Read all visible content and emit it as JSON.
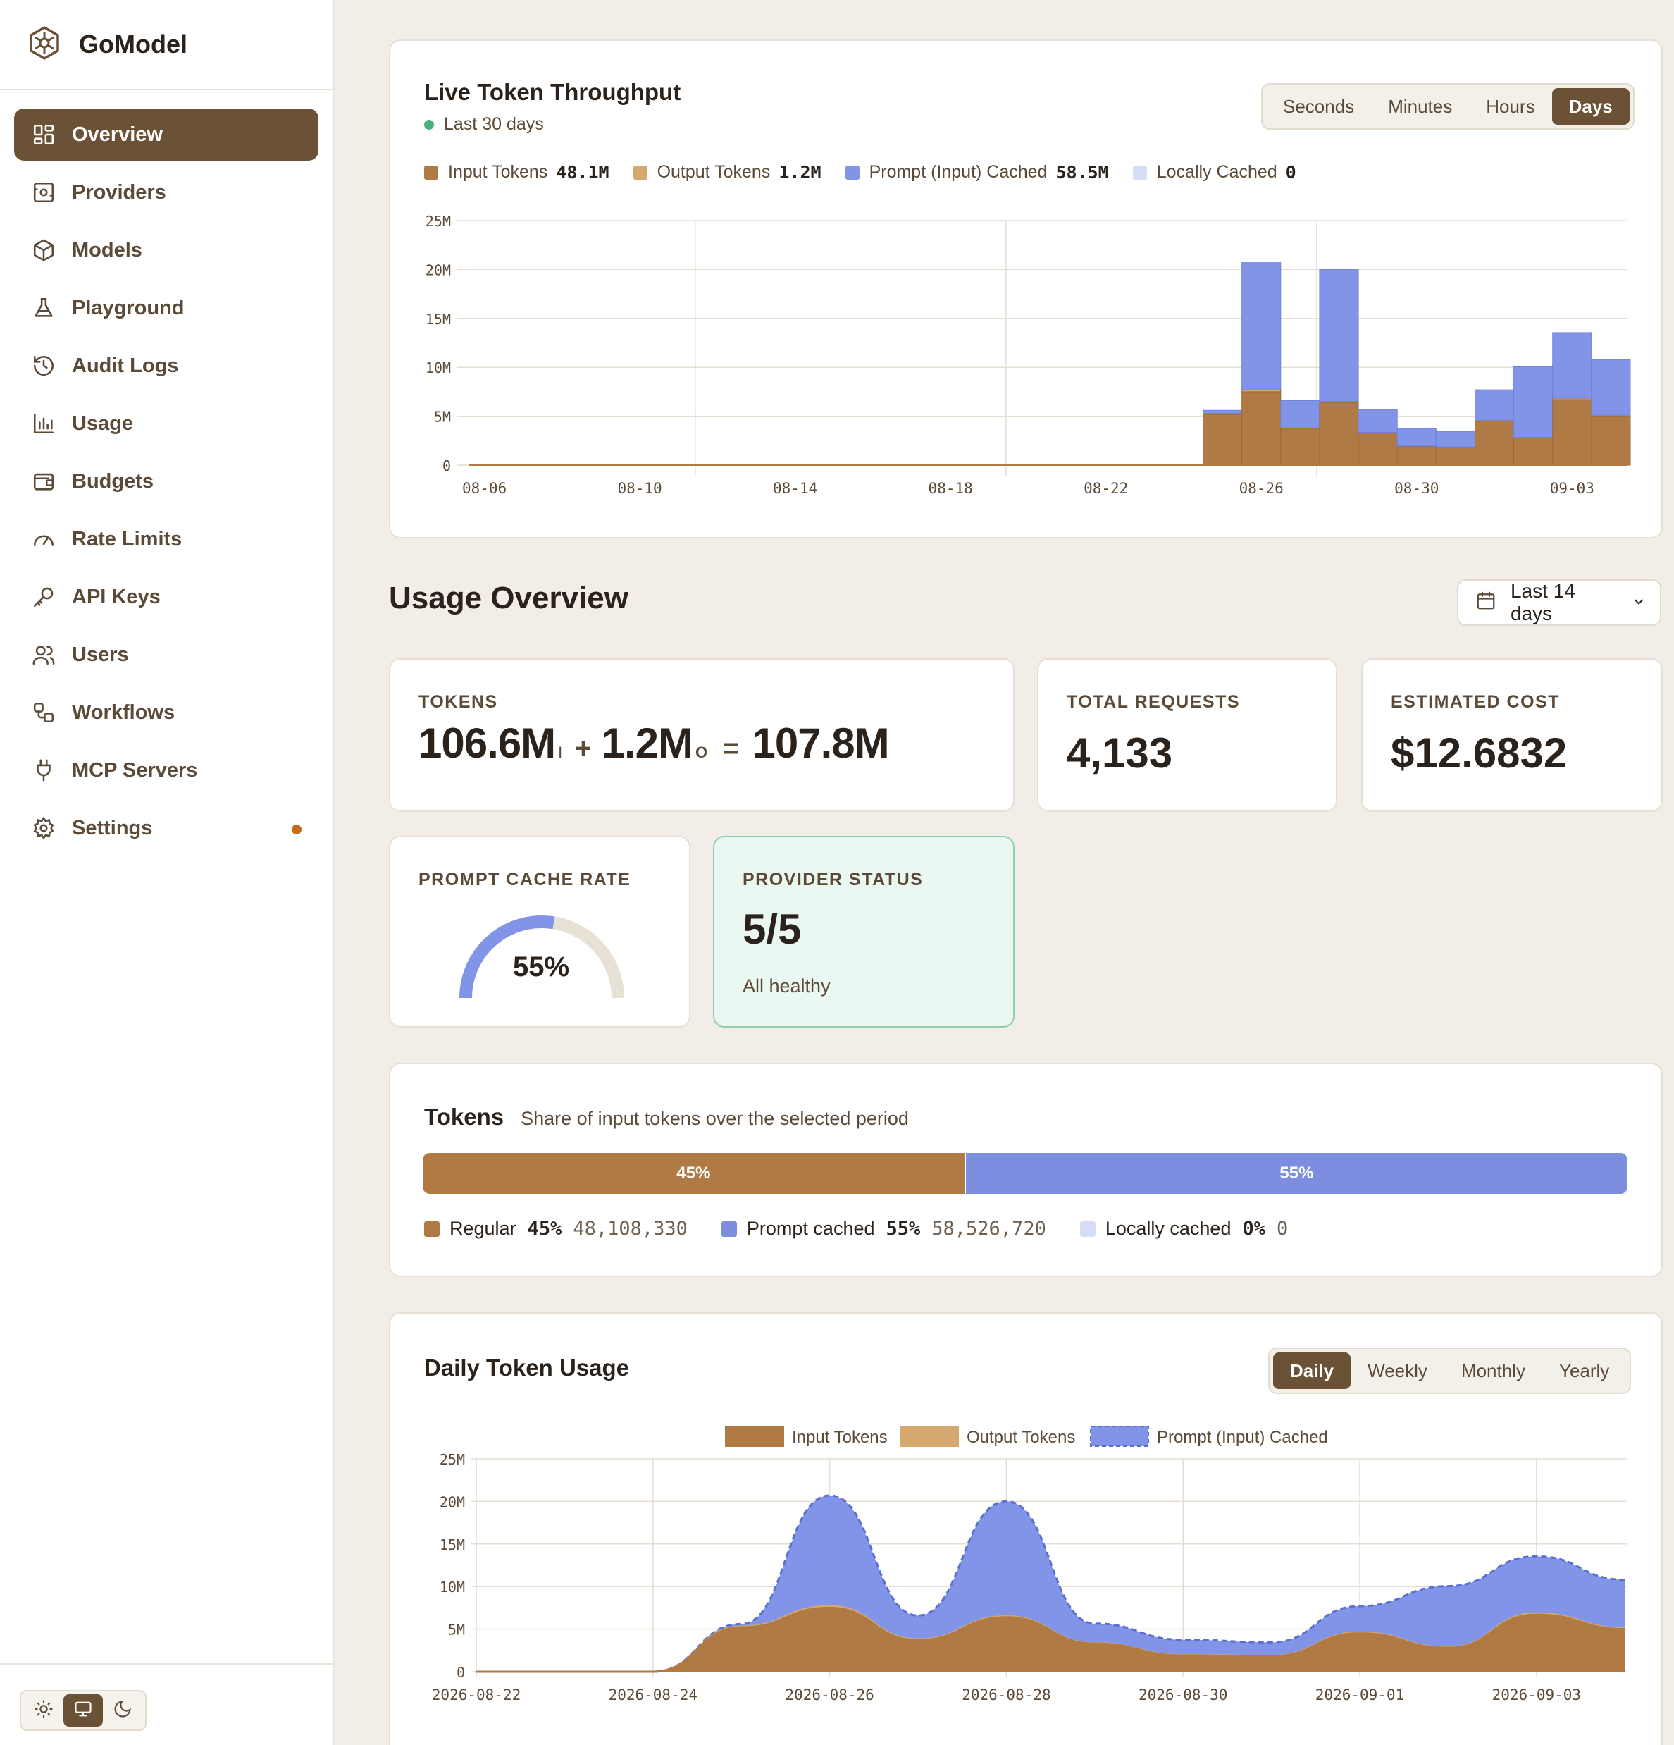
{
  "app": {
    "name": "GoModel"
  },
  "sidebar": {
    "items": [
      {
        "label": "Overview",
        "icon": "layout-grid-icon",
        "active": true
      },
      {
        "label": "Providers",
        "icon": "server-icon"
      },
      {
        "label": "Models",
        "icon": "cube-icon"
      },
      {
        "label": "Playground",
        "icon": "flask-icon"
      },
      {
        "label": "Audit Logs",
        "icon": "history-icon"
      },
      {
        "label": "Usage",
        "icon": "bar-chart-icon"
      },
      {
        "label": "Budgets",
        "icon": "wallet-icon"
      },
      {
        "label": "Rate Limits",
        "icon": "gauge-icon"
      },
      {
        "label": "API Keys",
        "icon": "key-icon"
      },
      {
        "label": "Users",
        "icon": "users-icon"
      },
      {
        "label": "Workflows",
        "icon": "workflow-icon"
      },
      {
        "label": "MCP Servers",
        "icon": "plug-icon"
      },
      {
        "label": "Settings",
        "icon": "gear-icon",
        "notification_dot": true
      }
    ],
    "theme_options": [
      "light",
      "system",
      "dark"
    ],
    "theme_selected": "system"
  },
  "throughput": {
    "title": "Live Token Throughput",
    "subtitle": "Last 30 days",
    "status_color": "#4caf7d",
    "granularity": [
      "Seconds",
      "Minutes",
      "Hours",
      "Days"
    ],
    "granularity_selected": "Days",
    "legend": [
      {
        "label": "Input Tokens",
        "value": "48.1M",
        "color": "#b07a45"
      },
      {
        "label": "Output Tokens",
        "value": "1.2M",
        "color": "#d4a86f"
      },
      {
        "label": "Prompt (Input) Cached",
        "value": "58.5M",
        "color": "#8294e8"
      },
      {
        "label": "Locally Cached",
        "value": "0",
        "color": "#d6ddf7"
      }
    ]
  },
  "usage_overview": {
    "title": "Usage Overview",
    "date_range": "Last 14 days",
    "tokens": {
      "label": "TOKENS",
      "input": "106.6M",
      "input_suffix": "I",
      "plus": "+",
      "output": "1.2M",
      "output_suffix": "O",
      "equals": "=",
      "total": "107.8M"
    },
    "total_requests": {
      "label": "TOTAL REQUESTS",
      "value": "4,133"
    },
    "estimated_cost": {
      "label": "ESTIMATED COST",
      "value": "$12.6832"
    },
    "prompt_cache_rate": {
      "label": "PROMPT CACHE RATE",
      "value": "55%",
      "fraction": 0.55
    },
    "provider_status": {
      "label": "PROVIDER STATUS",
      "value": "5/5",
      "note": "All healthy"
    }
  },
  "tokens_share": {
    "title": "Tokens",
    "subtitle": "Share of input tokens over the selected period",
    "segments": [
      {
        "label": "Regular",
        "pct": "45%",
        "fraction": 0.45,
        "count": "48,108,330",
        "color": "#b07a45"
      },
      {
        "label": "Prompt cached",
        "pct": "55%",
        "fraction": 0.55,
        "count": "58,526,720",
        "color": "#7d8ee0"
      },
      {
        "label": "Locally cached",
        "pct": "0%",
        "fraction": 0.0,
        "count": "0",
        "color": "#d6ddf7"
      }
    ]
  },
  "daily_usage": {
    "title": "Daily Token Usage",
    "periods": [
      "Daily",
      "Weekly",
      "Monthly",
      "Yearly"
    ],
    "period_selected": "Daily"
  },
  "chart_data": [
    {
      "type": "bar",
      "stacked": true,
      "categories": [
        "08-06",
        "08-07",
        "08-08",
        "08-09",
        "08-10",
        "08-11",
        "08-12",
        "08-13",
        "08-14",
        "08-15",
        "08-16",
        "08-17",
        "08-18",
        "08-19",
        "08-20",
        "08-21",
        "08-22",
        "08-23",
        "08-24",
        "08-25",
        "08-26",
        "08-27",
        "08-28",
        "08-29",
        "08-30",
        "08-31",
        "09-01",
        "09-02",
        "09-03",
        "09-04"
      ],
      "tick_labels": [
        "08-06",
        "08-10",
        "08-14",
        "08-18",
        "08-22",
        "08-26",
        "08-30",
        "09-03"
      ],
      "y_ticks": [
        "0",
        "5M",
        "10M",
        "15M",
        "20M",
        "25M"
      ],
      "ylim": [
        0,
        25000000
      ],
      "series": [
        {
          "name": "Input Tokens",
          "color": "#b07a45",
          "values": [
            0,
            0,
            0,
            0,
            0,
            0,
            0,
            0,
            0,
            0,
            0,
            0,
            0,
            0,
            0,
            0,
            0,
            0,
            0,
            5200000,
            7500000,
            3700000,
            6400000,
            3300000,
            1900000,
            1800000,
            4500000,
            2800000,
            6700000,
            5000000
          ]
        },
        {
          "name": "Output Tokens",
          "color": "#d4a86f",
          "values": [
            0,
            0,
            0,
            0,
            0,
            0,
            0,
            0,
            0,
            0,
            0,
            0,
            0,
            0,
            0,
            0,
            0,
            0,
            0,
            100000,
            200000,
            100000,
            100000,
            50000,
            50000,
            50000,
            100000,
            50000,
            150000,
            100000
          ]
        },
        {
          "name": "Prompt (Input) Cached",
          "color": "#8294e8",
          "values": [
            0,
            0,
            0,
            0,
            0,
            0,
            0,
            0,
            0,
            0,
            0,
            0,
            0,
            0,
            0,
            0,
            0,
            0,
            0,
            300000,
            13000000,
            2800000,
            13500000,
            2300000,
            1800000,
            1600000,
            3100000,
            7200000,
            6700000,
            5700000
          ]
        },
        {
          "name": "Locally Cached",
          "color": "#d6ddf7",
          "values": [
            0,
            0,
            0,
            0,
            0,
            0,
            0,
            0,
            0,
            0,
            0,
            0,
            0,
            0,
            0,
            0,
            0,
            0,
            0,
            0,
            0,
            0,
            0,
            0,
            0,
            0,
            0,
            0,
            0,
            0
          ]
        }
      ],
      "grid": true
    },
    {
      "type": "area",
      "stacked": true,
      "x": [
        "2026-08-22",
        "2026-08-23",
        "2026-08-24",
        "2026-08-25",
        "2026-08-26",
        "2026-08-27",
        "2026-08-28",
        "2026-08-29",
        "2026-08-30",
        "2026-08-31",
        "2026-09-01",
        "2026-09-02",
        "2026-09-03",
        "2026-09-04"
      ],
      "tick_labels": [
        "2026-08-22",
        "2026-08-24",
        "2026-08-26",
        "2026-08-28",
        "2026-08-30",
        "2026-09-01",
        "2026-09-03"
      ],
      "y_ticks": [
        "0",
        "5M",
        "10M",
        "15M",
        "20M",
        "25M"
      ],
      "ylim": [
        0,
        25000000
      ],
      "legend_position": "top-center",
      "series": [
        {
          "name": "Input Tokens",
          "color": "#b07a45",
          "values": [
            0,
            0,
            0,
            5200000,
            7500000,
            3700000,
            6400000,
            3300000,
            1900000,
            1800000,
            4500000,
            2800000,
            6700000,
            5000000
          ]
        },
        {
          "name": "Output Tokens",
          "color": "#d4a86f",
          "values": [
            0,
            0,
            0,
            100000,
            200000,
            100000,
            100000,
            50000,
            50000,
            50000,
            100000,
            50000,
            150000,
            100000
          ]
        },
        {
          "name": "Prompt (Input) Cached",
          "color": "#8294e8",
          "values": [
            0,
            0,
            0,
            300000,
            13000000,
            2800000,
            13500000,
            2300000,
            1800000,
            1600000,
            3100000,
            7200000,
            6700000,
            5700000
          ]
        }
      ],
      "grid": true
    }
  ]
}
